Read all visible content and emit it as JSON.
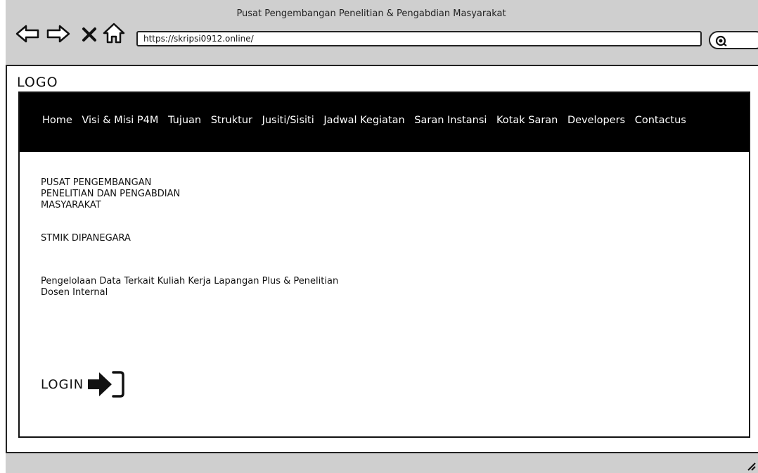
{
  "window": {
    "title": "Pusat Pengembangan Penelitian & Pengabdian Masyarakat",
    "url": "https://skripsi0912.online/"
  },
  "toolbar_icons": [
    "back-icon",
    "forward-icon",
    "stop-icon",
    "home-icon",
    "search-icon"
  ],
  "page": {
    "logo": "LOGO",
    "nav": [
      {
        "label": "Home"
      },
      {
        "label": "Visi & Misi P4M"
      },
      {
        "label": "Tujuan"
      },
      {
        "label": "Struktur"
      },
      {
        "label": "Jusiti/Sisiti"
      },
      {
        "label": "Jadwal Kegiatan"
      },
      {
        "label": "Saran Instansi"
      },
      {
        "label": "Kotak Saran"
      },
      {
        "label": "Developers"
      },
      {
        "label": "Contactus"
      }
    ],
    "org_title_lines": [
      "PUSAT PENGEMBANGAN",
      "PENELITIAN DAN PENGABDIAN",
      "MASYARAKAT"
    ],
    "campus": "STMIK DIPANEGARA",
    "description_lines": [
      "Pengelolaan Data Terkait Kuliah Kerja Lapangan Plus & Penelitian",
      "Dosen Internal"
    ],
    "login_label": "LOGIN",
    "login_icon": "login-arrow-icon"
  },
  "colors": {
    "chrome": "#cfcfcf",
    "navbar_bg": "#000000",
    "navbar_text": "#ffffff"
  }
}
